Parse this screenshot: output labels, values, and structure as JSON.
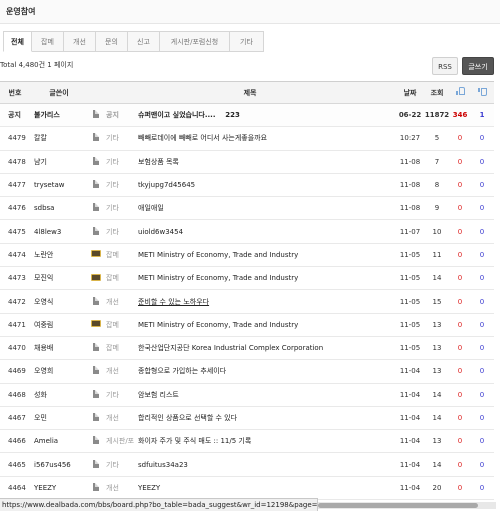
{
  "board": {
    "title": "운영참여",
    "tabs": [
      "전체",
      "잡메",
      "개선",
      "문의",
      "신고",
      "게시판/포럼신청",
      "기타"
    ],
    "total_text": "Total 4,480건 1 페이지",
    "rss_label": "RSS",
    "write_label": "글쓰기"
  },
  "table": {
    "headers": {
      "num": "번호",
      "author": "글쓴이",
      "title": "제목",
      "date": "날짜",
      "views": "조회"
    },
    "rows": [
      {
        "num": "공지",
        "author": "불가리스",
        "icon": "doc",
        "category": "공지",
        "title": "슈퍼맨이고 싶었습니다....",
        "comments": "223",
        "date": "06-22",
        "views": "11872",
        "up": "346",
        "down": "1",
        "notice": true
      },
      {
        "num": "4479",
        "author": "칼칼",
        "icon": "doc",
        "category": "기타",
        "title": "빼빼로데이에 빼빼로 어디서 사는게좋을까요",
        "comments": "",
        "date": "10:27",
        "views": "5",
        "up": "0",
        "down": "0"
      },
      {
        "num": "4478",
        "author": "냠기",
        "icon": "doc",
        "category": "기타",
        "title": "보험상품 목록",
        "comments": "",
        "date": "11-08",
        "views": "7",
        "up": "0",
        "down": "0"
      },
      {
        "num": "4477",
        "author": "trysetaw",
        "icon": "doc",
        "category": "기타",
        "title": "tkyjupg7d45645",
        "comments": "",
        "date": "11-08",
        "views": "8",
        "up": "0",
        "down": "0"
      },
      {
        "num": "4476",
        "author": "sdbsa",
        "icon": "doc",
        "category": "기타",
        "title": "애일애일",
        "comments": "",
        "date": "11-08",
        "views": "9",
        "up": "0",
        "down": "0"
      },
      {
        "num": "4475",
        "author": "4l8lew3",
        "icon": "doc",
        "category": "기타",
        "title": "uiold6w3454",
        "comments": "",
        "date": "11-07",
        "views": "10",
        "up": "0",
        "down": "0"
      },
      {
        "num": "4474",
        "author": "노란안",
        "icon": "photo",
        "category": "잡메",
        "title": "METI Ministry of Economy, Trade and Industry",
        "comments": "",
        "date": "11-05",
        "views": "11",
        "up": "0",
        "down": "0"
      },
      {
        "num": "4473",
        "author": "모진익",
        "icon": "photo",
        "category": "잡메",
        "title": "METI Ministry of Economy, Trade and Industry",
        "comments": "",
        "date": "11-05",
        "views": "14",
        "up": "0",
        "down": "0"
      },
      {
        "num": "4472",
        "author": "오영식",
        "icon": "doc",
        "category": "개선",
        "title": "준비할 수 있는 노하우다",
        "comments": "",
        "date": "11-05",
        "views": "15",
        "up": "0",
        "down": "0",
        "underline": true
      },
      {
        "num": "4471",
        "author": "여중림",
        "icon": "photo",
        "category": "잡메",
        "title": "METI Ministry of Economy, Trade and Industry",
        "comments": "",
        "date": "11-05",
        "views": "13",
        "up": "0",
        "down": "0"
      },
      {
        "num": "4470",
        "author": "채용배",
        "icon": "doc",
        "category": "잡메",
        "title": "한국산업단지공단 Korea Industrial Complex Corporation",
        "comments": "",
        "date": "11-05",
        "views": "13",
        "up": "0",
        "down": "0"
      },
      {
        "num": "4469",
        "author": "오영희",
        "icon": "doc",
        "category": "개선",
        "title": "종합형으로 가입하는 추세이다",
        "comments": "",
        "date": "11-04",
        "views": "13",
        "up": "0",
        "down": "0"
      },
      {
        "num": "4468",
        "author": "성화",
        "icon": "doc",
        "category": "기타",
        "title": "암보험 리스트",
        "comments": "",
        "date": "11-04",
        "views": "14",
        "up": "0",
        "down": "0"
      },
      {
        "num": "4467",
        "author": "오민",
        "icon": "doc",
        "category": "개선",
        "title": "합리적인 상품으로 선택할 수 있다",
        "comments": "",
        "date": "11-04",
        "views": "14",
        "up": "0",
        "down": "0"
      },
      {
        "num": "4466",
        "author": "Amelia",
        "icon": "doc",
        "category": "게시판/포럼신청",
        "title": "화이자 주가 및 주식 매도 :: 11/5 기록",
        "comments": "",
        "date": "11-04",
        "views": "13",
        "up": "0",
        "down": "0"
      },
      {
        "num": "4465",
        "author": "i567us456",
        "icon": "doc",
        "category": "기타",
        "title": "sdfuitus34a23",
        "comments": "",
        "date": "11-04",
        "views": "14",
        "up": "0",
        "down": "0"
      },
      {
        "num": "4464",
        "author": "YEEZY",
        "icon": "doc",
        "category": "개선",
        "title": "YEEZY",
        "comments": "",
        "date": "11-04",
        "views": "20",
        "up": "0",
        "down": "0"
      }
    ]
  },
  "status_url": "https://www.dealbada.com/bbs/board.php?bo_table=bada_suggest&wr_id=12198&page=1"
}
